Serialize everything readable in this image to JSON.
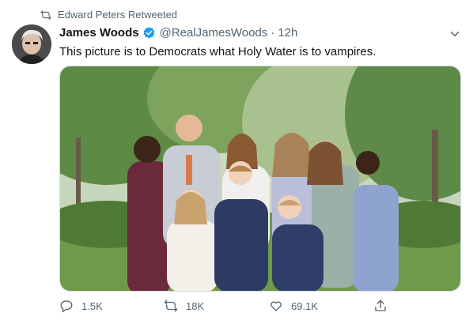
{
  "retweet": {
    "text": "Edward Peters Retweeted"
  },
  "tweet": {
    "name": "James Woods",
    "handle": "@RealJamesWoods",
    "separator": "·",
    "time": "12h",
    "text": "This picture is to Democrats what Holy Water is to vampires."
  },
  "actions": {
    "replies": "1.5K",
    "retweets": "18K",
    "likes": "69.1K"
  },
  "colors": {
    "secondary_text": "#536471",
    "verified_blue": "#1d9bf0",
    "primary_text": "#0f1419"
  }
}
